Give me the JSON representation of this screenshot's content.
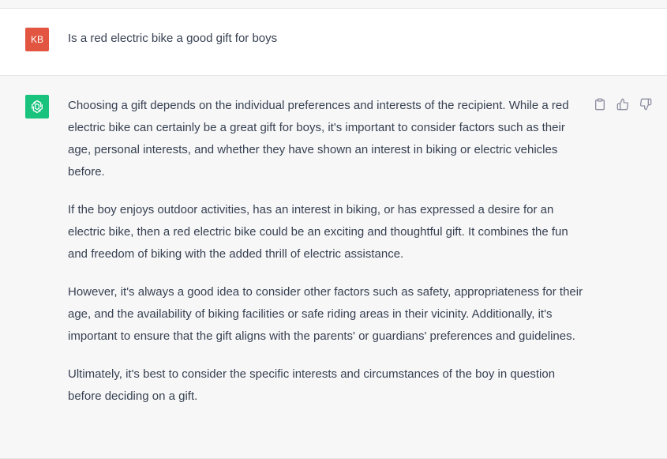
{
  "user_message": {
    "avatar_initials": "KB",
    "avatar_color": "#e25540",
    "text": "Is a red electric bike a good gift for boys"
  },
  "assistant_message": {
    "avatar_icon": "openai-logo-icon",
    "avatar_color": "#19c37d",
    "paragraphs": [
      "Choosing a gift depends on the individual preferences and interests of the recipient. While a red electric bike can certainly be a great gift for boys, it's important to consider factors such as their age, personal interests, and whether they have shown an interest in biking or electric vehicles before.",
      "If the boy enjoys outdoor activities, has an interest in biking, or has expressed a desire for an electric bike, then a red electric bike could be an exciting and thoughtful gift. It combines the fun and freedom of biking with the added thrill of electric assistance.",
      "However, it's always a good idea to consider other factors such as safety, appropriateness for their age, and the availability of biking facilities or safe riding areas in their vicinity. Additionally, it's important to ensure that the gift aligns with the parents' or guardians' preferences and guidelines.",
      "Ultimately, it's best to consider the specific interests and circumstances of the boy in question before deciding on a gift."
    ],
    "actions": [
      {
        "icon": "clipboard-icon"
      },
      {
        "icon": "thumbs-up-icon"
      },
      {
        "icon": "thumbs-down-icon"
      }
    ]
  }
}
